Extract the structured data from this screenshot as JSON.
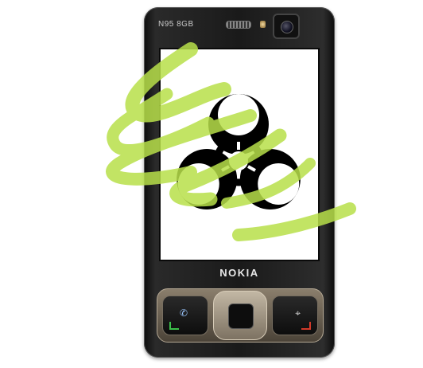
{
  "device": {
    "model_label": "N95 8GB",
    "brand_label": "NOKIA"
  },
  "screen": {
    "symbol_icon": "biohazard-icon",
    "background": "#ffffff",
    "symbol_color": "#000000"
  },
  "overlay": {
    "scribble_color": "#b8e04a",
    "scribble_opacity": 0.85
  },
  "keys": {
    "left_icon": "call-icon",
    "right_icon": "menu-icon",
    "navigation_icon": "dpad-icon"
  }
}
